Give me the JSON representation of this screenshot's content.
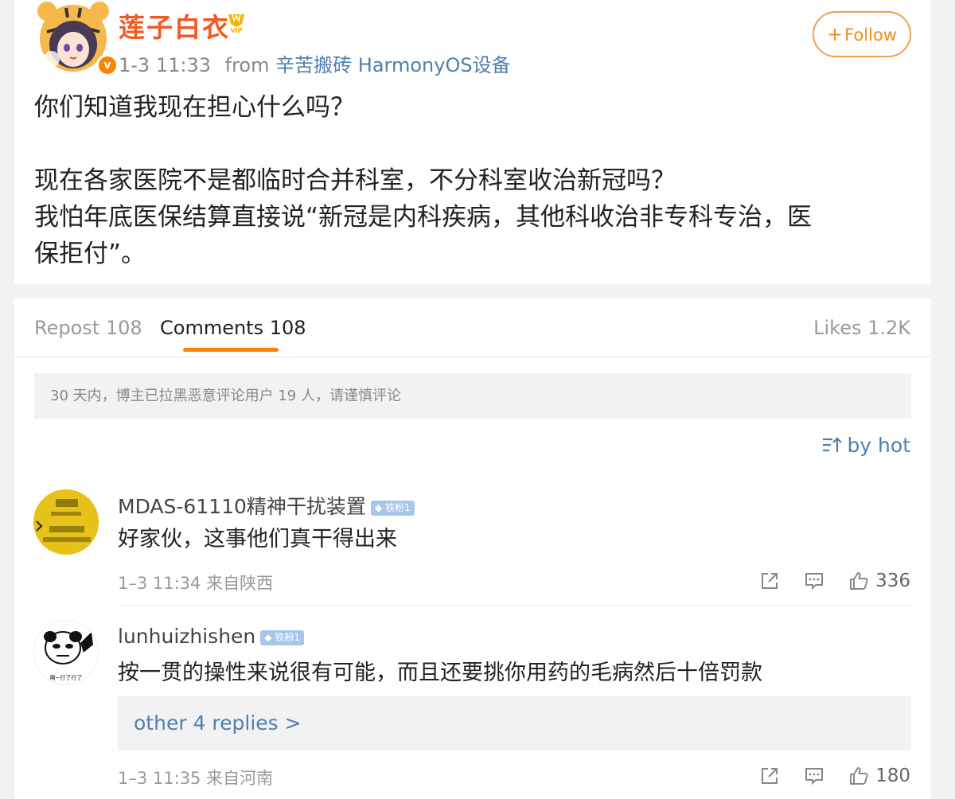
{
  "post": {
    "author": "莲子白衣",
    "time": "1-3 11:33",
    "from_label": "from",
    "device": "辛苦搬砖 HarmonyOS设备",
    "follow_label": "Follow",
    "body_lines": [
      "你们知道我现在担心什么吗？",
      "",
      "现在各家医院不是都临时合并科室，不分科室收治新冠吗？",
      "我怕年底医保结算直接说“新冠是内科疾病，其他科收治非专科专治，医",
      "保拒付”。"
    ]
  },
  "tabs": {
    "repost": "Repost 108",
    "comments": "Comments 108",
    "likes": "Likes 1.2K"
  },
  "notice": "30 天内，博主已拉黑恶意评论用户 19 人，请谨慎评论",
  "sort_label": "by hot",
  "comments": [
    {
      "name": "MDAS-61110精神干扰装置",
      "badge": "铁粉1",
      "text": "好家伙，这事他们真干得出来",
      "time_location": "1–3 11:34 来自陕西",
      "likes": "336"
    },
    {
      "name": "lunhuizhishen",
      "badge": "铁粉1",
      "text": "按一贯的操性来说很有可能，而且还要挑你用药的毛病然后十倍罚款",
      "replies_label": "other 4 replies >",
      "time_location": "1–3 11:35 来自河南",
      "likes": "180"
    }
  ],
  "colors": {
    "author": "#f15a24",
    "link": "#4f7fad",
    "follow": "#f08b22",
    "tab_underline": "#ff8200"
  },
  "icons": [
    "verified-icon",
    "vip-icon",
    "plus-icon",
    "sort-icon",
    "share-icon",
    "comment-icon",
    "like-icon"
  ]
}
